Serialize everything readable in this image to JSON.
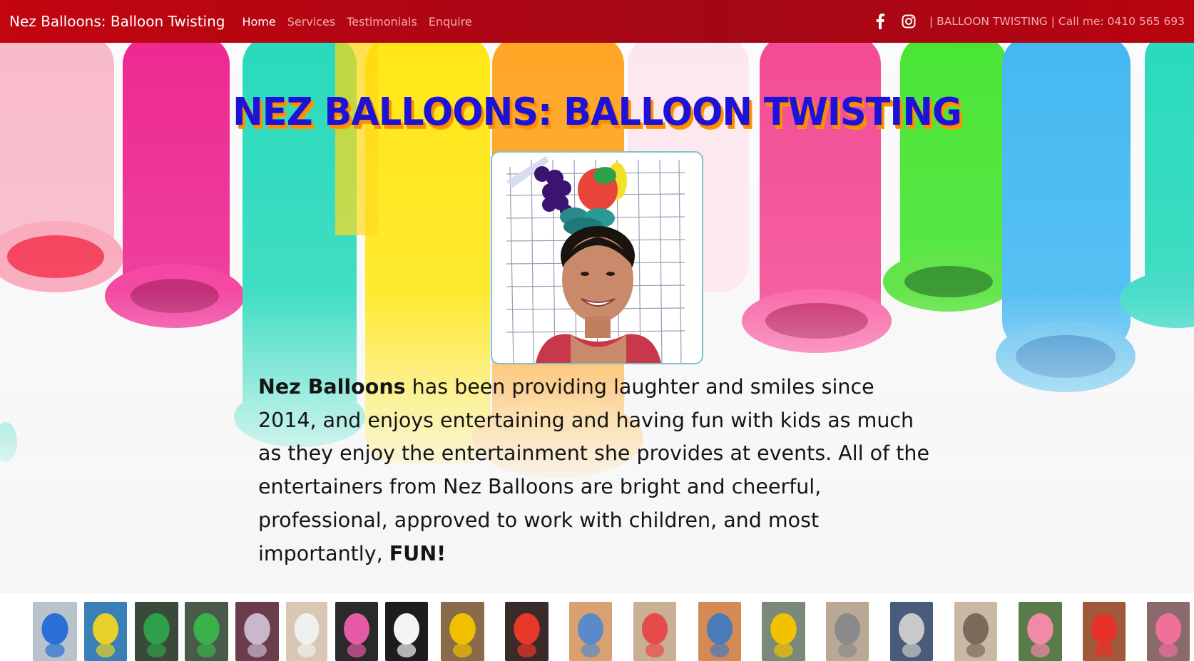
{
  "navbar": {
    "brand": "Nez Balloons: Balloon Twisting",
    "links": [
      {
        "label": "Home",
        "active": true
      },
      {
        "label": "Services",
        "active": false
      },
      {
        "label": "Testimonials",
        "active": false
      },
      {
        "label": "Enquire",
        "active": false
      }
    ],
    "social": [
      "facebook-icon",
      "instagram-icon"
    ],
    "tagline": "| BALLOON TWISTING | Call me: 0410 565 693"
  },
  "hero": {
    "title": "NEZ BALLOONS: BALLOON TWISTING",
    "intro_bold_name": "Nez Balloons",
    "intro_text": " has been providing laughter and smiles since 2014, and enjoys entertaining and having fun with kids as much as they enjoy the entertainment she provides at events. All of the entertainers from Nez Balloons are bright and cheerful, professional, approved to work with children, and most importantly, ",
    "intro_bold_end": "FUN!"
  },
  "colors": {
    "nav_bg": "#b0061a",
    "title_blue": "#1d12d8",
    "title_shadow": "#ff8a00",
    "portrait_border": "#7ec3c6"
  },
  "gallery": {
    "thumbnails": [
      {
        "name": "balloon-heart",
        "bg": "#b9c3cc",
        "accent": "#2a6fd6"
      },
      {
        "name": "balloon-flower-bouquet",
        "bg": "#3a7fb5",
        "accent": "#e8d02a"
      },
      {
        "name": "balloon-christmas-tree",
        "bg": "#3a4a3a",
        "accent": "#2ea04a"
      },
      {
        "name": "balloon-christmas-tree-2",
        "bg": "#4a5a4a",
        "accent": "#39b24c"
      },
      {
        "name": "balloon-rabbit",
        "bg": "#6b3d4a",
        "accent": "#c9b8c9"
      },
      {
        "name": "balloon-unicorn",
        "bg": "#d9c7b5",
        "accent": "#f0f0f0"
      },
      {
        "name": "balloon-bouquet-mixed",
        "bg": "#2a2a2a",
        "accent": "#e45aa5"
      },
      {
        "name": "balloon-unicorn-2",
        "bg": "#1d1d1d",
        "accent": "#f4f4f4"
      },
      {
        "name": "balloon-hat-girl",
        "bg": "#8a6a4a",
        "accent": "#f0c000"
      },
      {
        "name": "balloon-rocket",
        "bg": "#3a2a2a",
        "accent": "#e8382a"
      },
      {
        "name": "balloon-dragonfly",
        "bg": "#d9a070",
        "accent": "#5a8ac8"
      },
      {
        "name": "balloon-ladybug",
        "bg": "#c9b095",
        "accent": "#e54b4b"
      },
      {
        "name": "balloon-robot",
        "bg": "#d48a55",
        "accent": "#4a7ab8"
      },
      {
        "name": "balloon-digger",
        "bg": "#7a8a7a",
        "accent": "#f2c200"
      },
      {
        "name": "balloon-mouse",
        "bg": "#b8a895",
        "accent": "#8a8a8a"
      },
      {
        "name": "balloon-rabbit-2",
        "bg": "#4a5a7a",
        "accent": "#c9c9c9"
      },
      {
        "name": "balloon-cat",
        "bg": "#c8b8a5",
        "accent": "#7a6a5a"
      },
      {
        "name": "balloon-flamingo",
        "bg": "#5a7a4a",
        "accent": "#f08aa5"
      },
      {
        "name": "balloon-rainbow",
        "bg": "#a05a3a",
        "accent": "#e8302a"
      },
      {
        "name": "balloon-pig",
        "bg": "#8a6a6a",
        "accent": "#f0709a"
      }
    ]
  }
}
